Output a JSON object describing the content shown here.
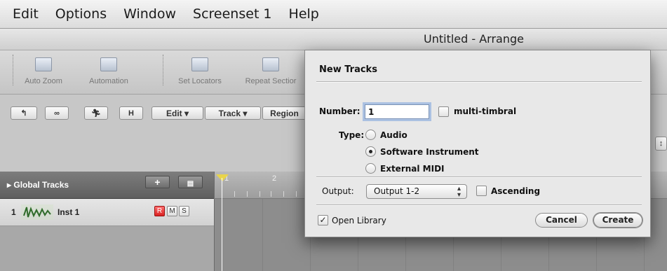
{
  "menubar": {
    "items": [
      "Edit",
      "Options",
      "Window",
      "Screenset 1",
      "Help"
    ]
  },
  "window": {
    "title": "Untitled - Arrange"
  },
  "toolbar": {
    "auto_zoom": "Auto Zoom",
    "automation": "Automation",
    "set_locators": "Set Locators",
    "repeat_section": "Repeat Sectior"
  },
  "subbar": {
    "btn_h": "H",
    "edit_menu": "Edit ▾",
    "track_menu": "Track ▾",
    "region_menu": "Region"
  },
  "global_tracks": {
    "label": "Global Tracks",
    "add": "+"
  },
  "track": {
    "number": "1",
    "name": "Inst 1",
    "record": "R",
    "mute": "M",
    "solo": "S"
  },
  "ruler": {
    "bar1": "1",
    "bar2": "2"
  },
  "dialog": {
    "title": "New Tracks",
    "number_label": "Number:",
    "number_value": "1",
    "multi_timbral_label": "multi-timbral",
    "multi_timbral_checked": false,
    "type_label": "Type:",
    "types": [
      "Audio",
      "Software Instrument",
      "External MIDI"
    ],
    "selected_type": "Software Instrument",
    "output_label": "Output:",
    "output_value": "Output 1-2",
    "ascending_label": "Ascending",
    "ascending_checked": false,
    "open_library_label": "Open Library",
    "open_library_checked": true,
    "cancel_label": "Cancel",
    "create_label": "Create"
  }
}
